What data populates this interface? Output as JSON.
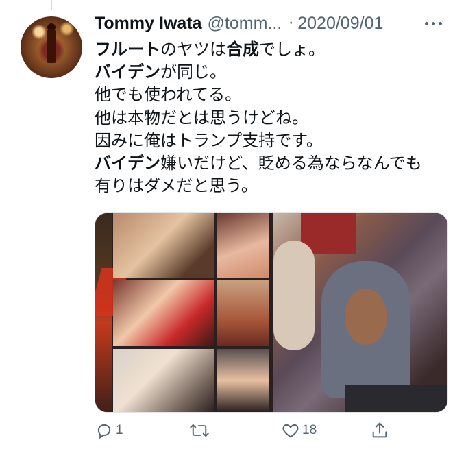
{
  "tweet": {
    "author_name": "Tommy Iwata",
    "handle": "@tomm...",
    "separator": "·",
    "date": "2020/09/01",
    "lines": [
      [
        {
          "t": "フルート",
          "b": true
        },
        {
          "t": "のヤツは",
          "b": false
        },
        {
          "t": "合成",
          "b": true
        },
        {
          "t": "でしょ。",
          "b": false
        }
      ],
      [
        {
          "t": "バイデン",
          "b": true
        },
        {
          "t": "が同じ。",
          "b": false
        }
      ],
      [
        {
          "t": "他でも使われてる。",
          "b": false
        }
      ],
      [
        {
          "t": "他は本物だとは思うけどね。",
          "b": false
        }
      ],
      [
        {
          "t": "因みに俺はトランプ支持です。",
          "b": false
        }
      ],
      [
        {
          "t": "バイデン",
          "b": true
        },
        {
          "t": "嫌いだけど、貶める為ならなんでも",
          "b": false
        }
      ],
      [
        {
          "t": "有りはダメだと思う。",
          "b": false
        }
      ]
    ]
  },
  "actions": {
    "reply_count": "1",
    "retweet_count": "",
    "like_count": "18"
  },
  "icons": {
    "reply": "reply-icon",
    "retweet": "retweet-icon",
    "like": "heart-icon",
    "share": "share-icon",
    "more": "more-icon"
  },
  "colors": {
    "text_primary": "#0f1419",
    "text_secondary": "#536471"
  }
}
